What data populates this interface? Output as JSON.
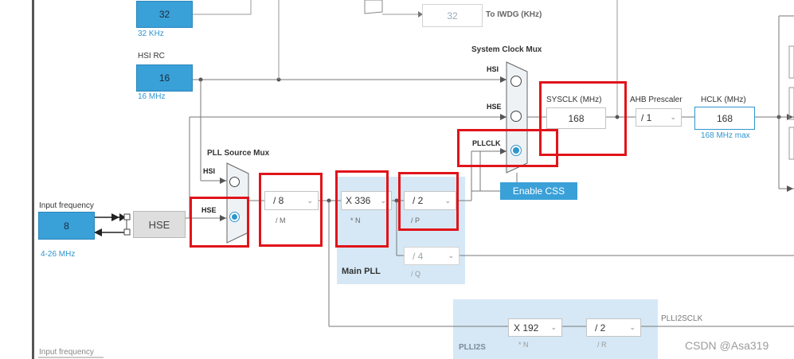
{
  "osc": {
    "lse_value": "32",
    "lse_note": "32 KHz",
    "iwdg_value": "32",
    "iwdg_label": "To IWDG (KHz)",
    "hsi_label": "HSI RC",
    "hsi_value": "16",
    "hsi_note": "16 MHz",
    "input_freq_label": "Input frequency",
    "input_freq_value": "8",
    "input_freq_range": "4-26 MHz",
    "hse_label": "HSE",
    "input_freq_label_bottom": "Input frequency"
  },
  "pll_mux": {
    "title": "PLL Source Mux",
    "hsi": "HSI",
    "hse": "HSE",
    "selected": "HSE"
  },
  "main_pll": {
    "title": "Main PLL",
    "m_value": "/ 8",
    "m_label": "/ M",
    "n_value": "X 336",
    "n_label": "* N",
    "p_value": "/ 2",
    "p_label": "/ P",
    "q_value": "/ 4",
    "q_label": "/ Q"
  },
  "plli2s": {
    "title": "PLLI2S",
    "n_value": "X 192",
    "n_label": "* N",
    "r_value": "/ 2",
    "r_label": "/ R",
    "clk_label": "PLLI2SCLK"
  },
  "sys_mux": {
    "title": "System Clock Mux",
    "hsi": "HSI",
    "hse": "HSE",
    "pllclk": "PLLCLK",
    "selected": "PLLCLK",
    "css_button": "Enable CSS"
  },
  "sysclk": {
    "label": "SYSCLK (MHz)",
    "value": "168"
  },
  "ahb": {
    "label": "AHB Prescaler",
    "value": "/ 1"
  },
  "hclk": {
    "label": "HCLK (MHz)",
    "value": "168",
    "note": "168 MHz max"
  },
  "watermark": "CSDN @Asa319",
  "colors": {
    "accent": "#3aa0d8",
    "panel": "#d6e8f6",
    "highlight": "#e0141a"
  }
}
